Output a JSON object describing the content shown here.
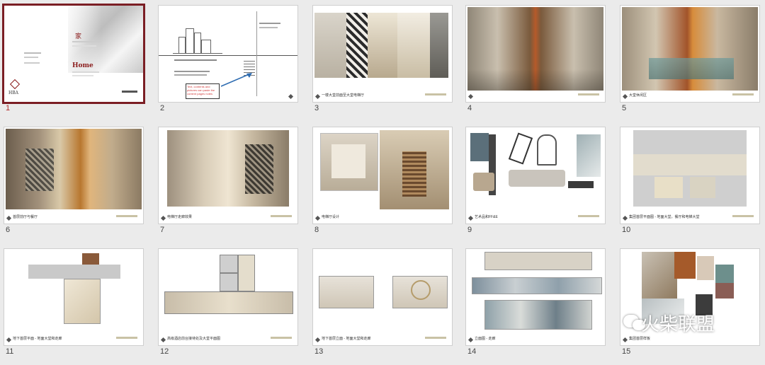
{
  "slides": [
    {
      "num": "1",
      "cover_title": "家",
      "cover_home": "Home",
      "cover_logo": "HBA"
    },
    {
      "num": "2",
      "note": "Text, contents and pictures can paste the content pages notes"
    },
    {
      "num": "3",
      "caption": "一楼大堂前面至大堂电梯厅"
    },
    {
      "num": "4"
    },
    {
      "num": "5",
      "caption": "大堂休闲区"
    },
    {
      "num": "6",
      "caption": "首层前厅与餐厅"
    },
    {
      "num": "7",
      "caption": "电梯厅走廊效果"
    },
    {
      "num": "8",
      "caption": "电梯厅设计"
    },
    {
      "num": "9",
      "caption": "艺术品和FF&E"
    },
    {
      "num": "10",
      "caption": "集团首层平面图 - 地面大堂，餐厅和电梯大堂"
    },
    {
      "num": "11",
      "caption": "地下首层平面 - 地面大堂和走廊"
    },
    {
      "num": "12",
      "caption": "高级酒店前台接待处及大堂平面图"
    },
    {
      "num": "13",
      "caption": "地下首层立面 - 地面大堂和走廊"
    },
    {
      "num": "14",
      "caption": "立面图 - 走廊"
    },
    {
      "num": "15",
      "caption": "集团首层样板"
    }
  ],
  "watermark": {
    "text": "火柴联盟"
  },
  "colors": {
    "selection": "#7b1e24",
    "number_selected": "#b32a2a",
    "brand_red": "#8a1b1b",
    "note_red": "#d23b3b",
    "arrow_blue": "#2f6db2"
  }
}
